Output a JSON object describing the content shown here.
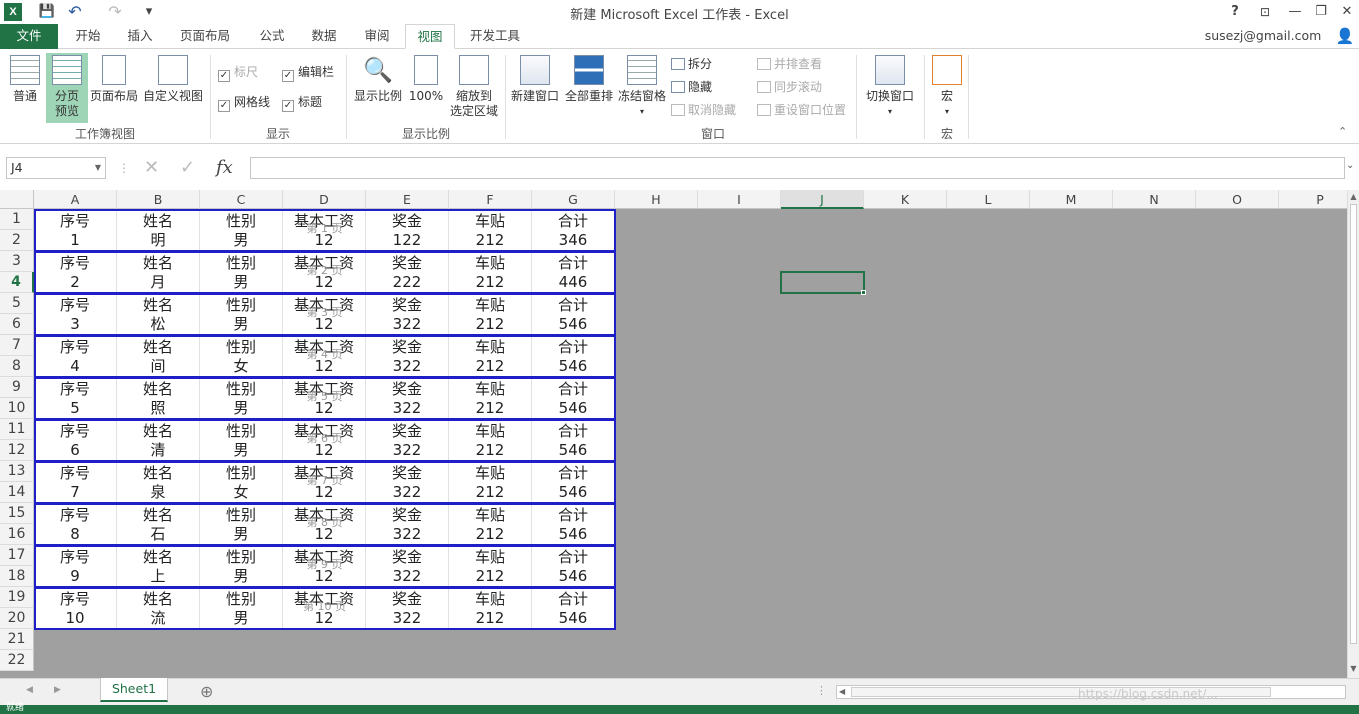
{
  "window": {
    "title": "新建 Microsoft Excel 工作表 - Excel",
    "help": "?",
    "min": "—",
    "restore": "❐",
    "close": "✕",
    "app_icon_text": "X"
  },
  "qat": {
    "save_icon": "💾",
    "undo_icon": "↶",
    "redo_icon": "↷",
    "more_icon": "▾"
  },
  "tabs": {
    "file": "文件",
    "items": [
      "开始",
      "插入",
      "页面布局",
      "公式",
      "数据",
      "审阅",
      "视图",
      "开发工具"
    ],
    "active": "视图",
    "account": "susezj@gmail.com"
  },
  "ribbon": {
    "workbook_views": {
      "label": "工作簿视图",
      "normal": "普通",
      "page_break_1": "分页",
      "page_break_2": "预览",
      "page_layout": "页面布局",
      "custom": "自定义视图"
    },
    "show": {
      "label": "显示",
      "ruler": "标尺",
      "formula_bar": "编辑栏",
      "gridlines": "网格线",
      "headings": "标题"
    },
    "zoom": {
      "label": "显示比例",
      "zoom": "显示比例",
      "hundred": "100%",
      "to_selection_1": "缩放到",
      "to_selection_2": "选定区域"
    },
    "window": {
      "label": "窗口",
      "new_window": "新建窗口",
      "arrange_all": "全部重排",
      "freeze": "冻结窗格",
      "split": "拆分",
      "hide": "隐藏",
      "unhide": "取消隐藏",
      "side_by_side": "并排查看",
      "sync_scroll": "同步滚动",
      "reset_position": "重设窗口位置",
      "switch": "切换窗口"
    },
    "macros": {
      "label": "宏",
      "macros": "宏"
    }
  },
  "formula_bar": {
    "name_box": "J4",
    "cancel": "✕",
    "enter": "✓",
    "fx": "fx",
    "value": ""
  },
  "columns": [
    "A",
    "B",
    "C",
    "D",
    "E",
    "F",
    "G",
    "H",
    "I",
    "J",
    "K",
    "L",
    "M",
    "N",
    "O",
    "P"
  ],
  "selected_column": "J",
  "selected_row": "4",
  "row_numbers": [
    "1",
    "2",
    "3",
    "4",
    "5",
    "6",
    "7",
    "8",
    "9",
    "10",
    "11",
    "12",
    "13",
    "14",
    "15",
    "16",
    "17",
    "18",
    "19",
    "20",
    "21",
    "22"
  ],
  "header_row": [
    "序号",
    "姓名",
    "性别",
    "基本工资",
    "奖金",
    "车贴",
    "合计"
  ],
  "records": [
    [
      "1",
      "明",
      "男",
      "12",
      "122",
      "212",
      "346"
    ],
    [
      "2",
      "月",
      "男",
      "12",
      "222",
      "212",
      "446"
    ],
    [
      "3",
      "松",
      "男",
      "12",
      "322",
      "212",
      "546"
    ],
    [
      "4",
      "间",
      "女",
      "12",
      "322",
      "212",
      "546"
    ],
    [
      "5",
      "照",
      "男",
      "12",
      "322",
      "212",
      "546"
    ],
    [
      "6",
      "清",
      "男",
      "12",
      "322",
      "212",
      "546"
    ],
    [
      "7",
      "泉",
      "女",
      "12",
      "322",
      "212",
      "546"
    ],
    [
      "8",
      "石",
      "男",
      "12",
      "322",
      "212",
      "546"
    ],
    [
      "9",
      "上",
      "男",
      "12",
      "322",
      "212",
      "546"
    ],
    [
      "10",
      "流",
      "男",
      "12",
      "322",
      "212",
      "546"
    ]
  ],
  "page_watermarks": [
    "第 1 页",
    "第 2 页",
    "第 3 页",
    "第 4 页",
    "第 5 页",
    "第 6 页",
    "第 7 页",
    "第 8 页",
    "第 9 页",
    "第 10 页"
  ],
  "sheets": {
    "tabs": [
      "Sheet1"
    ],
    "add": "⊕"
  },
  "status": {
    "ready": "就绪",
    "url_watermark": "https://blog.csdn.net/..."
  }
}
